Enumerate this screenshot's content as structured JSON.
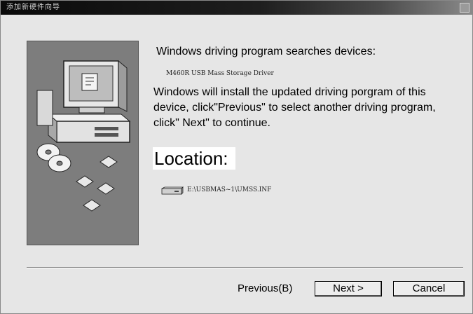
{
  "window": {
    "title": "添加新硬件向导"
  },
  "content": {
    "heading": "Windows driving program searches devices:",
    "driver_name": "M460R USB Mass Storage Driver",
    "description": "Windows will install the updated driving porgram of this device, click\"Previous\" to select another driving program, click\" Next\" to continue.",
    "location_label": "Location:",
    "file_path": "E:\\USBMAS~1\\UMSS.INF"
  },
  "buttons": {
    "previous": "Previous(B)",
    "next": "Next >",
    "cancel": "Cancel"
  },
  "icons": {
    "illustration": "computer-with-discs-illustration",
    "drive": "drive-icon"
  }
}
